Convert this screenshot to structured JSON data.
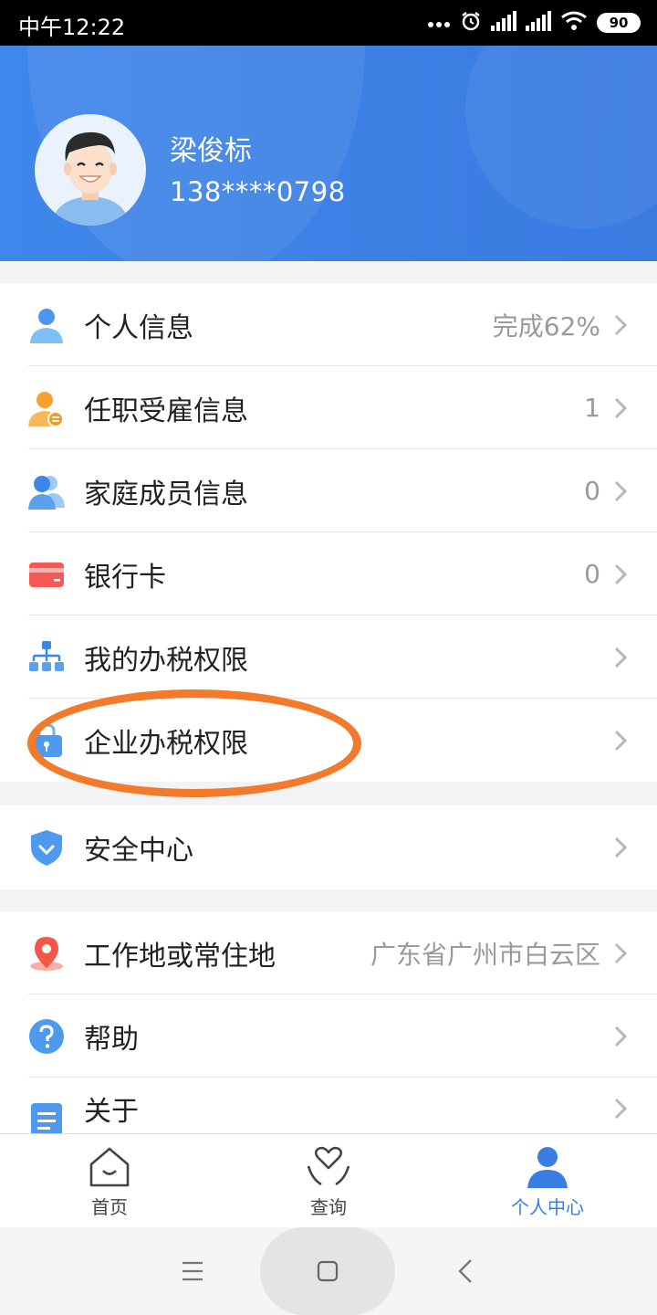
{
  "status_bar": {
    "time": "中午12:22",
    "battery": "90"
  },
  "profile": {
    "name": "梁俊标",
    "phone": "138****0798"
  },
  "menu_group_1": [
    {
      "label": "个人信息",
      "value": "完成62%",
      "icon": "person-icon"
    },
    {
      "label": "任职受雇信息",
      "value": "1",
      "icon": "employment-icon"
    },
    {
      "label": "家庭成员信息",
      "value": "0",
      "icon": "family-icon"
    },
    {
      "label": "银行卡",
      "value": "0",
      "icon": "bank-card-icon"
    },
    {
      "label": "我的办税权限",
      "value": "",
      "icon": "org-chart-icon"
    },
    {
      "label": "企业办税权限",
      "value": "",
      "icon": "enterprise-lock-icon"
    }
  ],
  "menu_group_2": [
    {
      "label": "安全中心",
      "value": "",
      "icon": "shield-icon"
    }
  ],
  "menu_group_3": [
    {
      "label": "工作地或常住地",
      "value": "广东省广州市白云区",
      "icon": "location-pin-icon"
    },
    {
      "label": "帮助",
      "value": "",
      "icon": "help-icon"
    },
    {
      "label": "关于",
      "value": "",
      "icon": "document-icon"
    }
  ],
  "tabbar": {
    "tabs": [
      {
        "label": "首页",
        "icon": "home-icon"
      },
      {
        "label": "查询",
        "icon": "heart-hands-icon"
      },
      {
        "label": "个人中心",
        "icon": "user-icon"
      }
    ],
    "active_index": 2
  },
  "colors": {
    "accent": "#3a7de3",
    "header": "#3f87ea",
    "annotation": "#f27a2a"
  }
}
